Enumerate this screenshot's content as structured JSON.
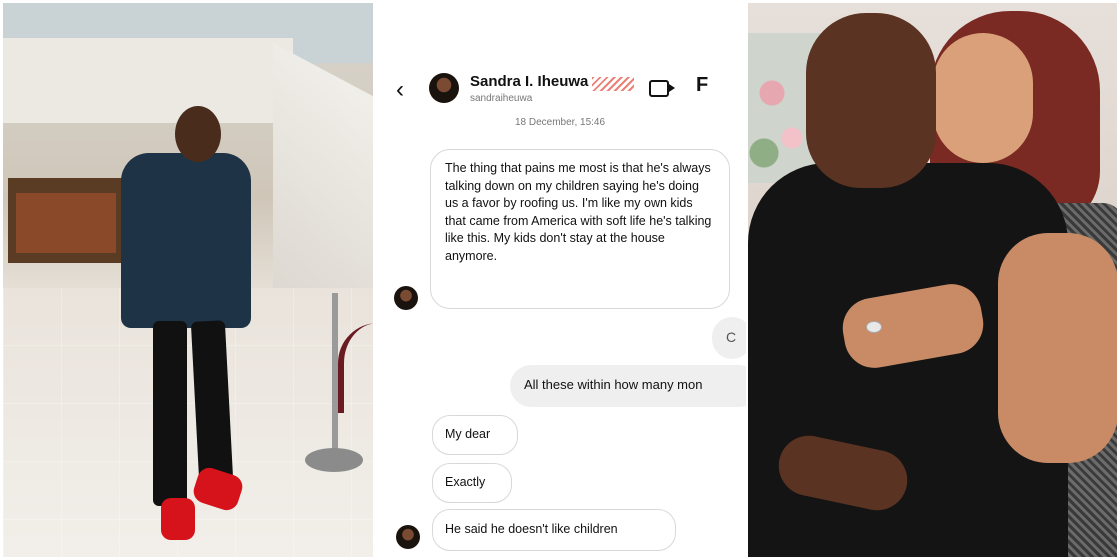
{
  "chat": {
    "contact_name": "Sandra I. Iheuwa",
    "contact_handle": "sandraiheuwa",
    "back_icon": "chevron-left-icon",
    "video_icon": "video-camera-icon",
    "info_icon": "info-icon",
    "date_stamp": "18 December, 15:46",
    "messages": [
      {
        "from": "contact",
        "text": "The thing that pains me most is that he's always talking down on my children saying he's doing us a favor by roofing us. I'm like my own kids that came from America with soft life he's talking like this. My kids don't stay at the house anymore."
      },
      {
        "from": "me",
        "text": "C"
      },
      {
        "from": "me",
        "text": "All these within how many mon"
      },
      {
        "from": "contact",
        "text": "My dear"
      },
      {
        "from": "contact",
        "text": "Exactly"
      },
      {
        "from": "contact",
        "text": "He said he doesn't like children"
      }
    ]
  },
  "photos": {
    "left": {
      "subject": "man-standing-in-lobby"
    },
    "right": {
      "subject": "couple-embracing"
    }
  },
  "colors": {
    "bubble_border": "#d8d8d8",
    "sent_bubble": "#efefef",
    "redaction": "#e24b3b"
  }
}
